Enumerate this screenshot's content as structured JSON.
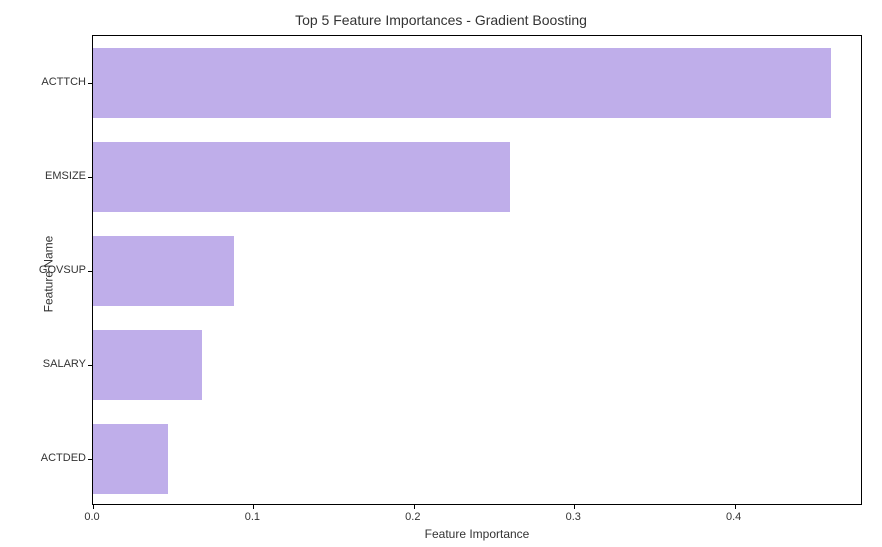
{
  "chart_data": {
    "type": "bar",
    "orientation": "horizontal",
    "categories": [
      "ACTTCH",
      "EMSIZE",
      "GOVSUP",
      "SALARY",
      "ACTDED"
    ],
    "values": [
      0.46,
      0.26,
      0.088,
      0.068,
      0.047
    ],
    "title": "Top 5 Feature Importances - Gradient Boosting",
    "xlabel": "Feature Importance",
    "ylabel": "Feature Name",
    "xlim": [
      0.0,
      0.48
    ],
    "xticks": [
      0.0,
      0.1,
      0.2,
      0.3,
      0.4
    ],
    "xtick_labels": [
      "0.0",
      "0.1",
      "0.2",
      "0.3",
      "0.4"
    ],
    "bar_color": "#bfaeea"
  }
}
